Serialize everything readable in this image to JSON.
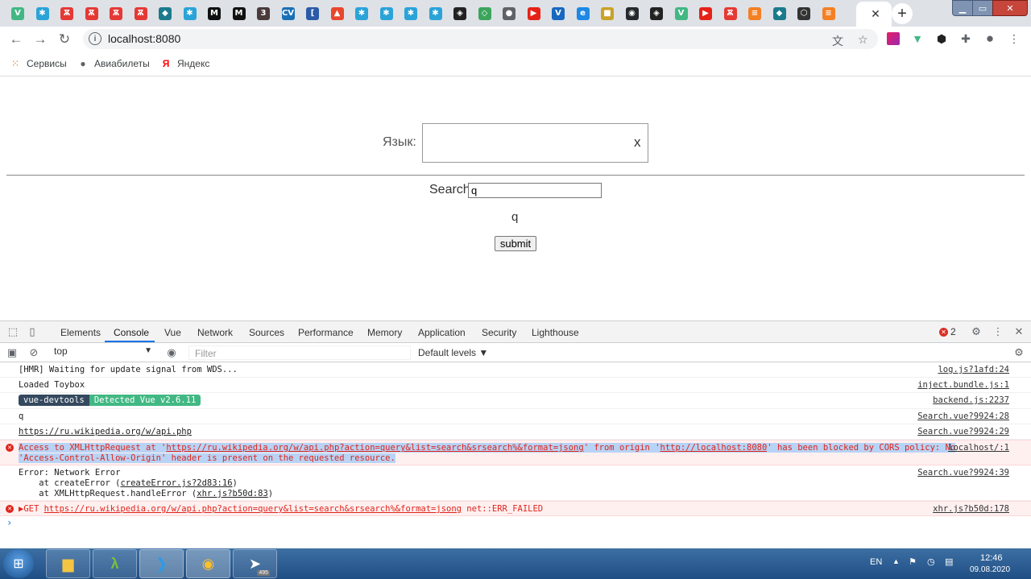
{
  "tabs": [
    {
      "icon": "vue-icon",
      "glyph": "V",
      "color": "#41b883"
    },
    {
      "icon": "snowflake-icon",
      "glyph": "✱",
      "color": "#2aa3d8"
    },
    {
      "icon": "ladybug-icon",
      "glyph": "Ѫ",
      "color": "#e53935"
    },
    {
      "icon": "ladybug-icon",
      "glyph": "Ѫ",
      "color": "#e53935"
    },
    {
      "icon": "ladybug-icon",
      "glyph": "Ѫ",
      "color": "#e53935"
    },
    {
      "icon": "ladybug-icon",
      "glyph": "Ѫ",
      "color": "#e53935"
    },
    {
      "icon": "teal-cap-icon",
      "glyph": "◆",
      "color": "#1b7a8c"
    },
    {
      "icon": "snowflake-icon",
      "glyph": "✱",
      "color": "#2aa3d8"
    },
    {
      "icon": "medium-icon",
      "glyph": "M",
      "color": "#111111"
    },
    {
      "icon": "medium-icon",
      "glyph": "M",
      "color": "#111111"
    },
    {
      "icon": "dark-square-icon",
      "glyph": "3",
      "color": "#4a3b3b"
    },
    {
      "icon": "cv-icon",
      "glyph": "CV",
      "color": "#1b6fb5"
    },
    {
      "icon": "bracket-icon",
      "glyph": "[",
      "color": "#2b5aa8"
    },
    {
      "icon": "flame-icon",
      "glyph": "▲",
      "color": "#e8472c"
    },
    {
      "icon": "asterisk-icon",
      "glyph": "✱",
      "color": "#2aa3d8"
    },
    {
      "icon": "asterisk-icon",
      "glyph": "✱",
      "color": "#2aa3d8"
    },
    {
      "icon": "asterisk-icon",
      "glyph": "✱",
      "color": "#2aa3d8"
    },
    {
      "icon": "asterisk-icon",
      "glyph": "✱",
      "color": "#2aa3d8"
    },
    {
      "icon": "codepen-icon",
      "glyph": "◈",
      "color": "#222222"
    },
    {
      "icon": "diamond-icon",
      "glyph": "◇",
      "color": "#3ba55c"
    },
    {
      "icon": "globe-icon",
      "glyph": "●",
      "color": "#5f6368"
    },
    {
      "icon": "youtube-icon",
      "glyph": "▶",
      "color": "#e62117"
    },
    {
      "icon": "vuetify-icon",
      "glyph": "V",
      "color": "#1867c0"
    },
    {
      "icon": "blue-circle-icon",
      "glyph": "e",
      "color": "#1e88e5"
    },
    {
      "icon": "folder-icon",
      "glyph": "■",
      "color": "#c9a227"
    },
    {
      "icon": "github-icon",
      "glyph": "◉",
      "color": "#24292e"
    },
    {
      "icon": "codepen-icon",
      "glyph": "◈",
      "color": "#222222"
    },
    {
      "icon": "vue-icon",
      "glyph": "V",
      "color": "#41b883"
    },
    {
      "icon": "youtube-icon",
      "glyph": "▶",
      "color": "#e62117"
    },
    {
      "icon": "ladybug-icon",
      "glyph": "Ѫ",
      "color": "#e53935"
    },
    {
      "icon": "stack-icon",
      "glyph": "≡",
      "color": "#f48024"
    },
    {
      "icon": "teal-cap-icon",
      "glyph": "◆",
      "color": "#1b7a8c"
    },
    {
      "icon": "hexagon-icon",
      "glyph": "⬡",
      "color": "#333333"
    },
    {
      "icon": "stack-icon",
      "glyph": "≡",
      "color": "#f48024"
    }
  ],
  "address_bar": {
    "url": "localhost:8080"
  },
  "bookmarks": [
    {
      "label": "Сервисы",
      "icon": "apps-grid-icon"
    },
    {
      "label": "Авиабилеты",
      "icon": "globe-icon"
    },
    {
      "label": "Яндекс",
      "icon": "yandex-icon"
    }
  ],
  "page": {
    "lang_label": "Язык:",
    "lang_clear": "x",
    "search_label": "Search",
    "search_value": "q",
    "echo_text": "q",
    "submit_label": "submit"
  },
  "devtools": {
    "tabs": [
      "Elements",
      "Console",
      "Vue",
      "Network",
      "Sources",
      "Performance",
      "Memory",
      "Application",
      "Security",
      "Lighthouse"
    ],
    "active_tab": "Console",
    "error_count": "2",
    "context": "top",
    "filter_placeholder": "Filter",
    "levels": "Default levels ▼"
  },
  "console": {
    "hmr": "[HMR] Waiting for update signal from WDS...",
    "hmr_src": "log.js?1afd:24",
    "toybox": "Loaded Toybox",
    "toybox_src": "inject.bundle.js:1",
    "badge_a": "vue-devtools",
    "badge_b": "Detected Vue v2.6.11",
    "badge_src": "backend.js:2237",
    "q": "q",
    "q_src": "Search.vue?9924:28",
    "api_url": "https://ru.wikipedia.org/w/api.php",
    "api_src": "Search.vue?9924:29",
    "cors_prefix": "Access to XMLHttpRequest at '",
    "cors_url": "https://ru.wikipedia.org/w/api.php?action=query&list=search&srsearch%&format=jsong",
    "cors_mid": "' from origin '",
    "cors_origin": "http://localhost:8080",
    "cors_suffix": "' has been blocked by CORS policy: No",
    "cors_line2": "'Access-Control-Allow-Origin' header is present on the requested resource.",
    "cors_src": "localhost/:1",
    "err_line1": "Error: Network Error",
    "err_line2_pre": "    at createError (",
    "err_line2_link": "createError.js?2d83:16",
    "err_line3_pre": "    at XMLHttpRequest.handleError (",
    "err_line3_link": "xhr.js?b50d:83",
    "err_close": ")",
    "err_src": "Search.vue?9924:39",
    "get_prefix": "▶GET ",
    "get_url": "https://ru.wikipedia.org/w/api.php?action=query&list=search&srsearch%&format=jsong",
    "get_suffix": " net::ERR_FAILED",
    "get_src": "xhr.js?b50d:178",
    "prompt": "›"
  },
  "taskbar": {
    "lang": "EN",
    "time": "12:46",
    "date": "09.08.2020",
    "telegram_badge": "495"
  },
  "colors": {
    "accent": "#1a73e8",
    "error": "#e0241b",
    "vue_green": "#41b883"
  }
}
